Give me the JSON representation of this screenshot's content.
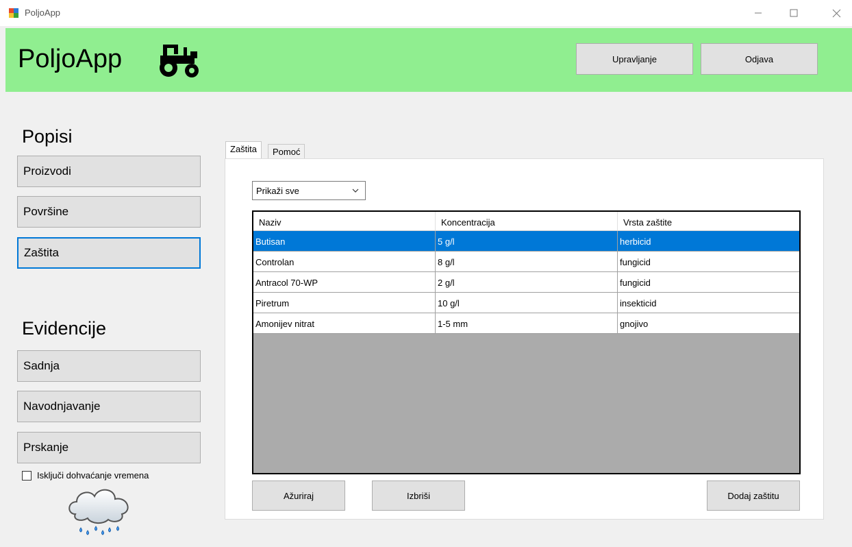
{
  "window": {
    "title": "PoljoApp"
  },
  "header": {
    "logo_text": "PoljoApp",
    "logo_icon": "tractor-icon",
    "buttons": {
      "upravljanje": "Upravljanje",
      "odjava": "Odjava"
    },
    "background_color": "#90ee90"
  },
  "sidebar": {
    "popisi_title": "Popisi",
    "popisi_items": [
      "Proizvodi",
      "Površine",
      "Zaštita"
    ],
    "active_item": "Zaštita",
    "evidencije_title": "Evidencije",
    "evidencije_items": [
      "Sadnja",
      "Navodnjavanje",
      "Prskanje"
    ],
    "weather_checkbox": {
      "label": "Isključi dohvaćanje vremena",
      "checked": false
    },
    "weather_icon": "rain-cloud-icon"
  },
  "tabs": [
    {
      "label": "Zaštita",
      "active": true
    },
    {
      "label": "Pomoć",
      "active": false
    }
  ],
  "filter": {
    "selected": "Prikaži sve"
  },
  "table": {
    "columns": [
      "Naziv",
      "Koncentracija",
      "Vrsta zaštite"
    ],
    "rows": [
      {
        "naziv": "Butisan",
        "koncentracija": "5 g/l",
        "vrsta": "herbicid",
        "selected": true
      },
      {
        "naziv": "Controlan",
        "koncentracija": "8 g/l",
        "vrsta": "fungicid",
        "selected": false
      },
      {
        "naziv": "Antracol 70-WP",
        "koncentracija": "2 g/l",
        "vrsta": "fungicid",
        "selected": false
      },
      {
        "naziv": "Piretrum",
        "koncentracija": "10 g/l",
        "vrsta": "insekticid",
        "selected": false
      },
      {
        "naziv": "Amonijev nitrat",
        "koncentracija": "1-5 mm",
        "vrsta": "gnojivo",
        "selected": false
      }
    ],
    "selection_color": "#0078d7"
  },
  "actions": {
    "azuriraj": "Ažuriraj",
    "izbrisi": "Izbriši",
    "dodaj": "Dodaj zaštitu"
  }
}
